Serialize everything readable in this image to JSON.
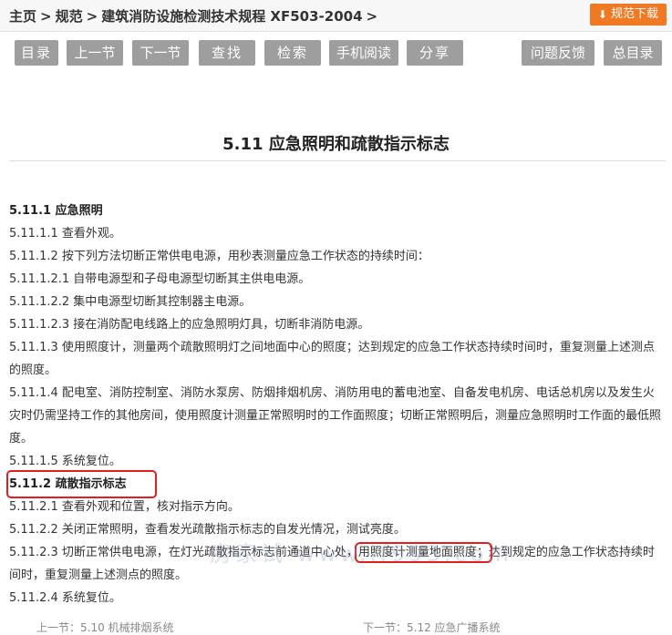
{
  "breadcrumb": {
    "items": [
      "主页",
      "规范",
      "建筑消防设施检测技术规程 XF503-2004"
    ],
    "separator": ">"
  },
  "download": {
    "label": "规范下载"
  },
  "toolbar": {
    "buttons": [
      "目录",
      "上一节",
      "下一节",
      "查找",
      "检索",
      "手机阅读",
      "分享"
    ],
    "right_buttons": [
      "问题反馈",
      "总目录"
    ]
  },
  "section": {
    "title": "5.11  应急照明和疏散指示标志"
  },
  "content": {
    "h1": "5.11.1 应急照明",
    "p1": "5.11.1.1 查看外观。",
    "p2": "5.11.1.2 按下列方法切断正常供电电源，用秒表测量应急工作状态的持续时间：",
    "p3": "5.11.1.2.1 自带电源型和子母电源型切断其主供电电源。",
    "p4": "5.11.1.2.2 集中电源型切断其控制器主电源。",
    "p5": "5.11.1.2.3 接在消防配电线路上的应急照明灯具，切断非消防电源。",
    "p6": "5.11.1.3 使用照度计，测量两个疏散照明灯之间地面中心的照度；达到规定的应急工作状态持续时间时，重复测量上述测点的照度。",
    "p7": "5.11.1.4 配电室、消防控制室、消防水泵房、防烟排烟机房、消防用电的蓄电池室、自备发电机房、电话总机房以及发生火灾时仍需坚持工作的其他房间，使用照度计测量正常照明时的工作面照度；切断正常照明后，测量应急照明时工作面的最低照度。",
    "p8": "5.11.1.5 系统复位。",
    "h2": "5.11.2 疏散指示标志",
    "p9": "5.11.2.1 查看外观和位置，核对指示方向。",
    "p10": "5.11.2.2 关闭正常照明，查看发光疏散指示标志的自发光情况，测试亮度。",
    "p11a": "5.11.2.3 切断正常供电电源，在灯光疏散指示标志前通道中心处，",
    "p11b": "用照度计测量地面照度；",
    "p11c": "达到规定的应急工作状态持续时间时，重复测量上述测点的照度。",
    "p12": "5.11.2.4 系统复位。"
  },
  "watermark": "房家试 www.if993.com",
  "footer": {
    "prev": "上一节：5.10 机械排烟系统",
    "next": "下一节：5.12 应急广播系统"
  },
  "colors": {
    "accent": "#f07a23",
    "button_gray": "#9e9e9e",
    "highlight_red": "#e02020"
  }
}
